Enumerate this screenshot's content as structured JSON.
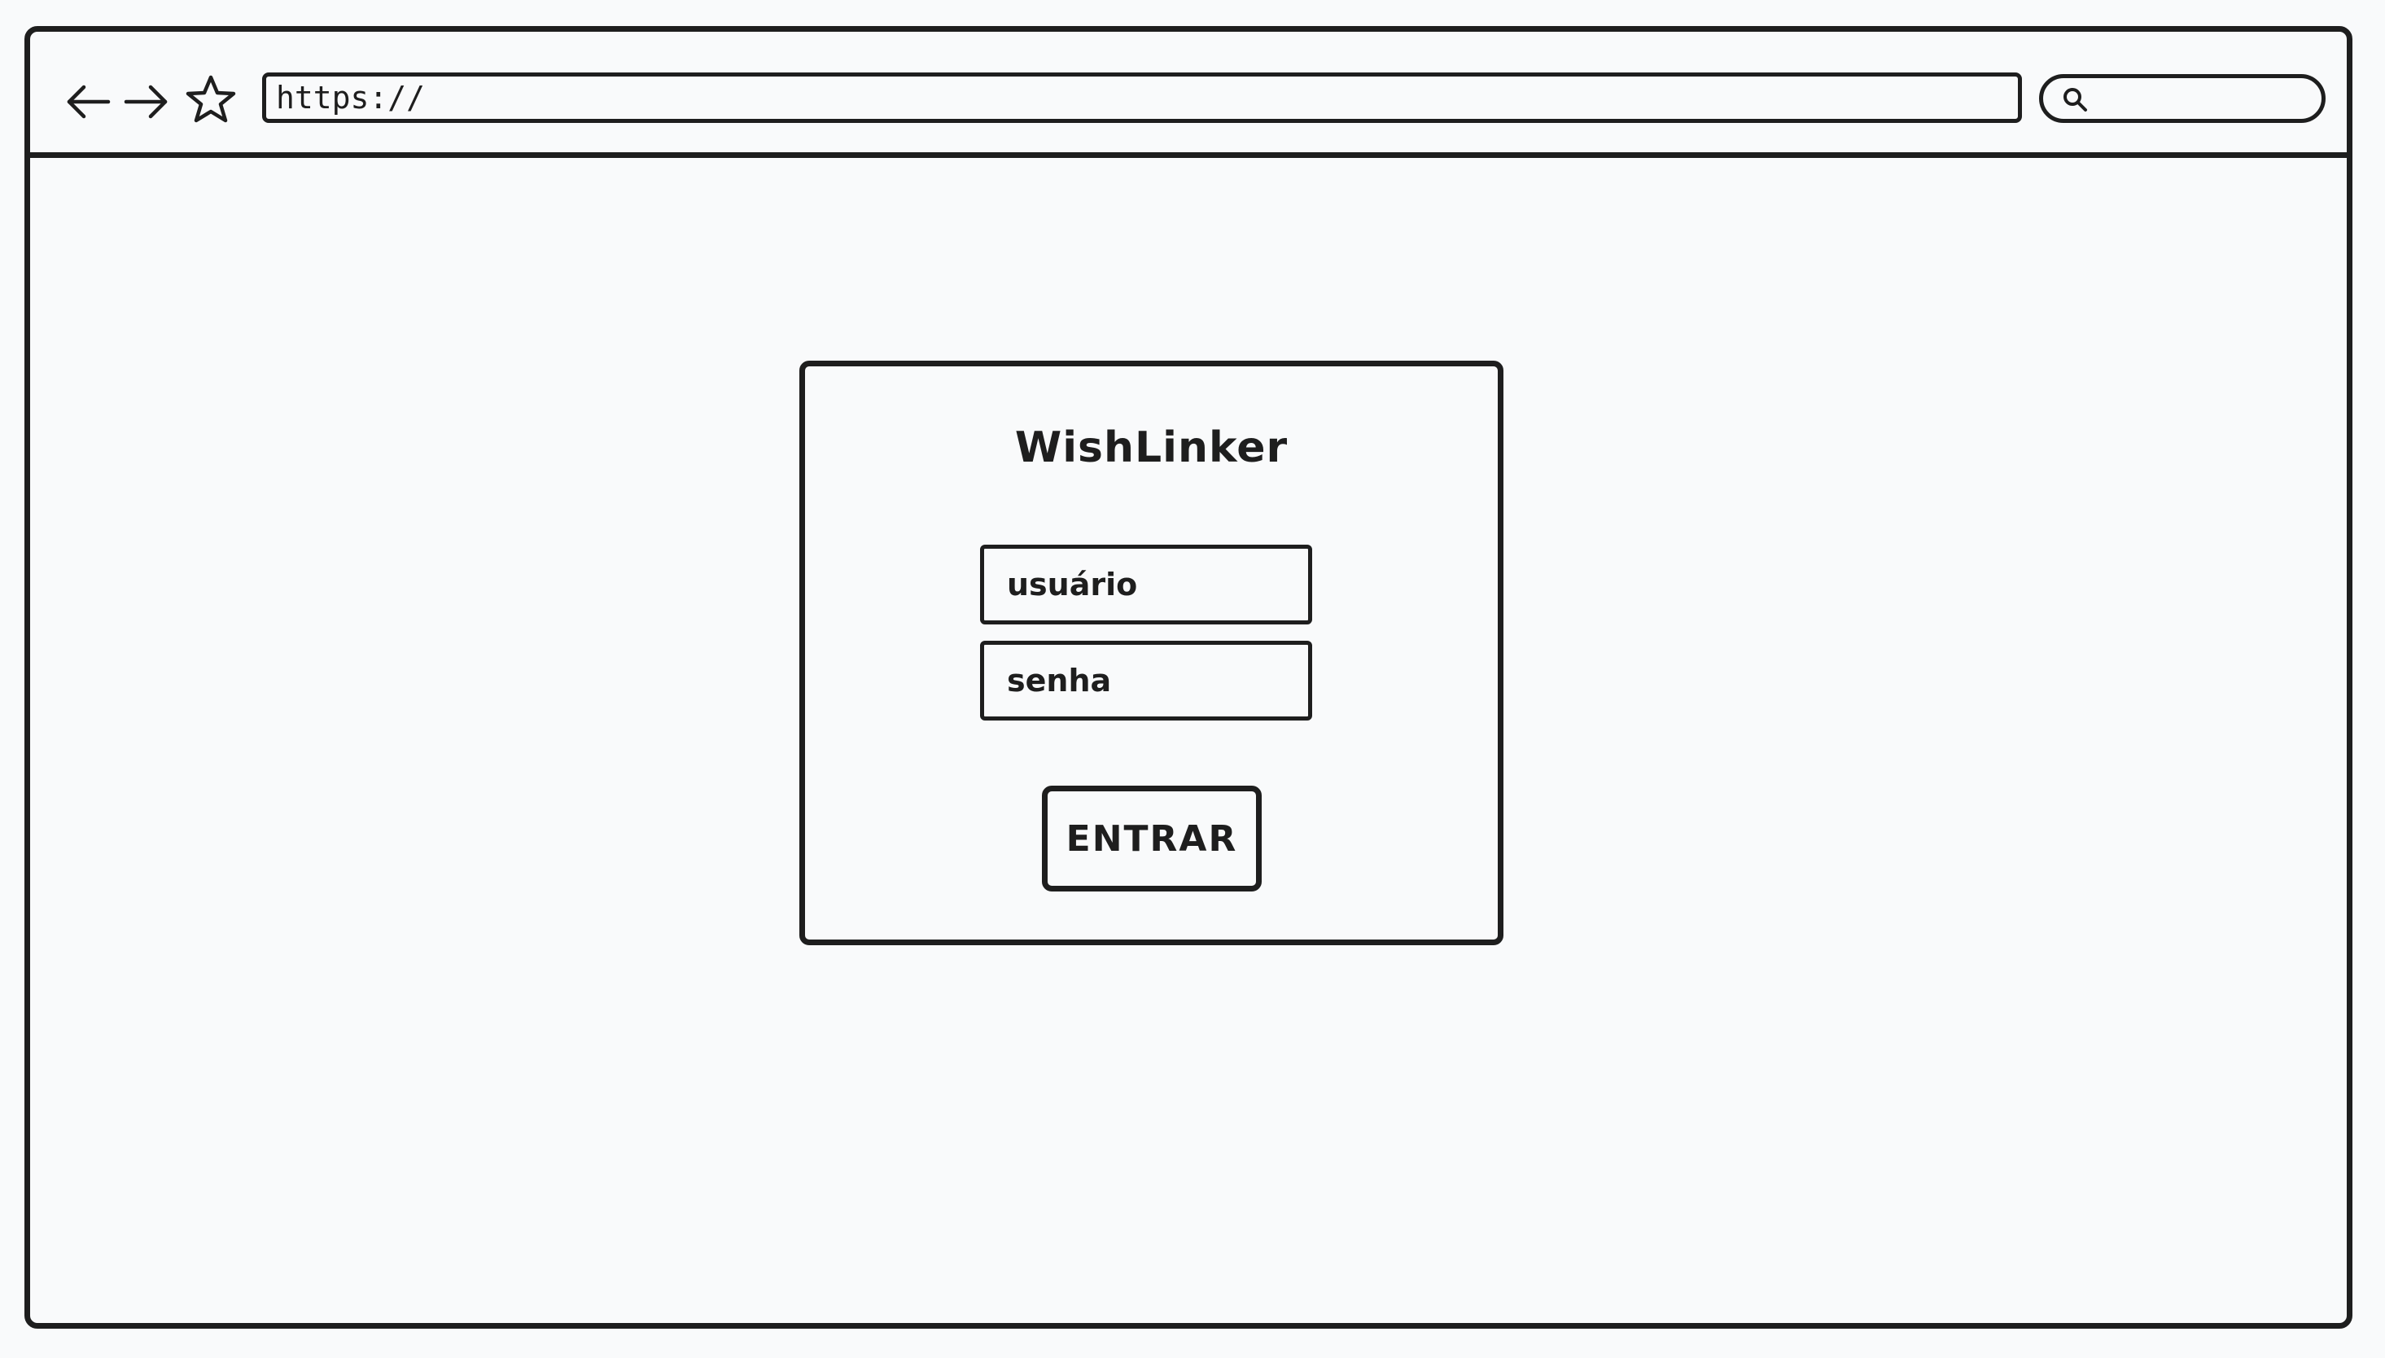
{
  "browser": {
    "address_bar": {
      "value": "https://"
    },
    "icons": {
      "back": "arrow-left-icon",
      "forward": "arrow-right-icon",
      "bookmark": "star-icon",
      "search": "search-icon"
    }
  },
  "login": {
    "title": "WishLinker",
    "username_placeholder": "usuário",
    "password_placeholder": "senha",
    "submit_label": "ENTRAR"
  },
  "colors": {
    "stroke": "#1e1e1e",
    "background": "#f9fafb"
  }
}
